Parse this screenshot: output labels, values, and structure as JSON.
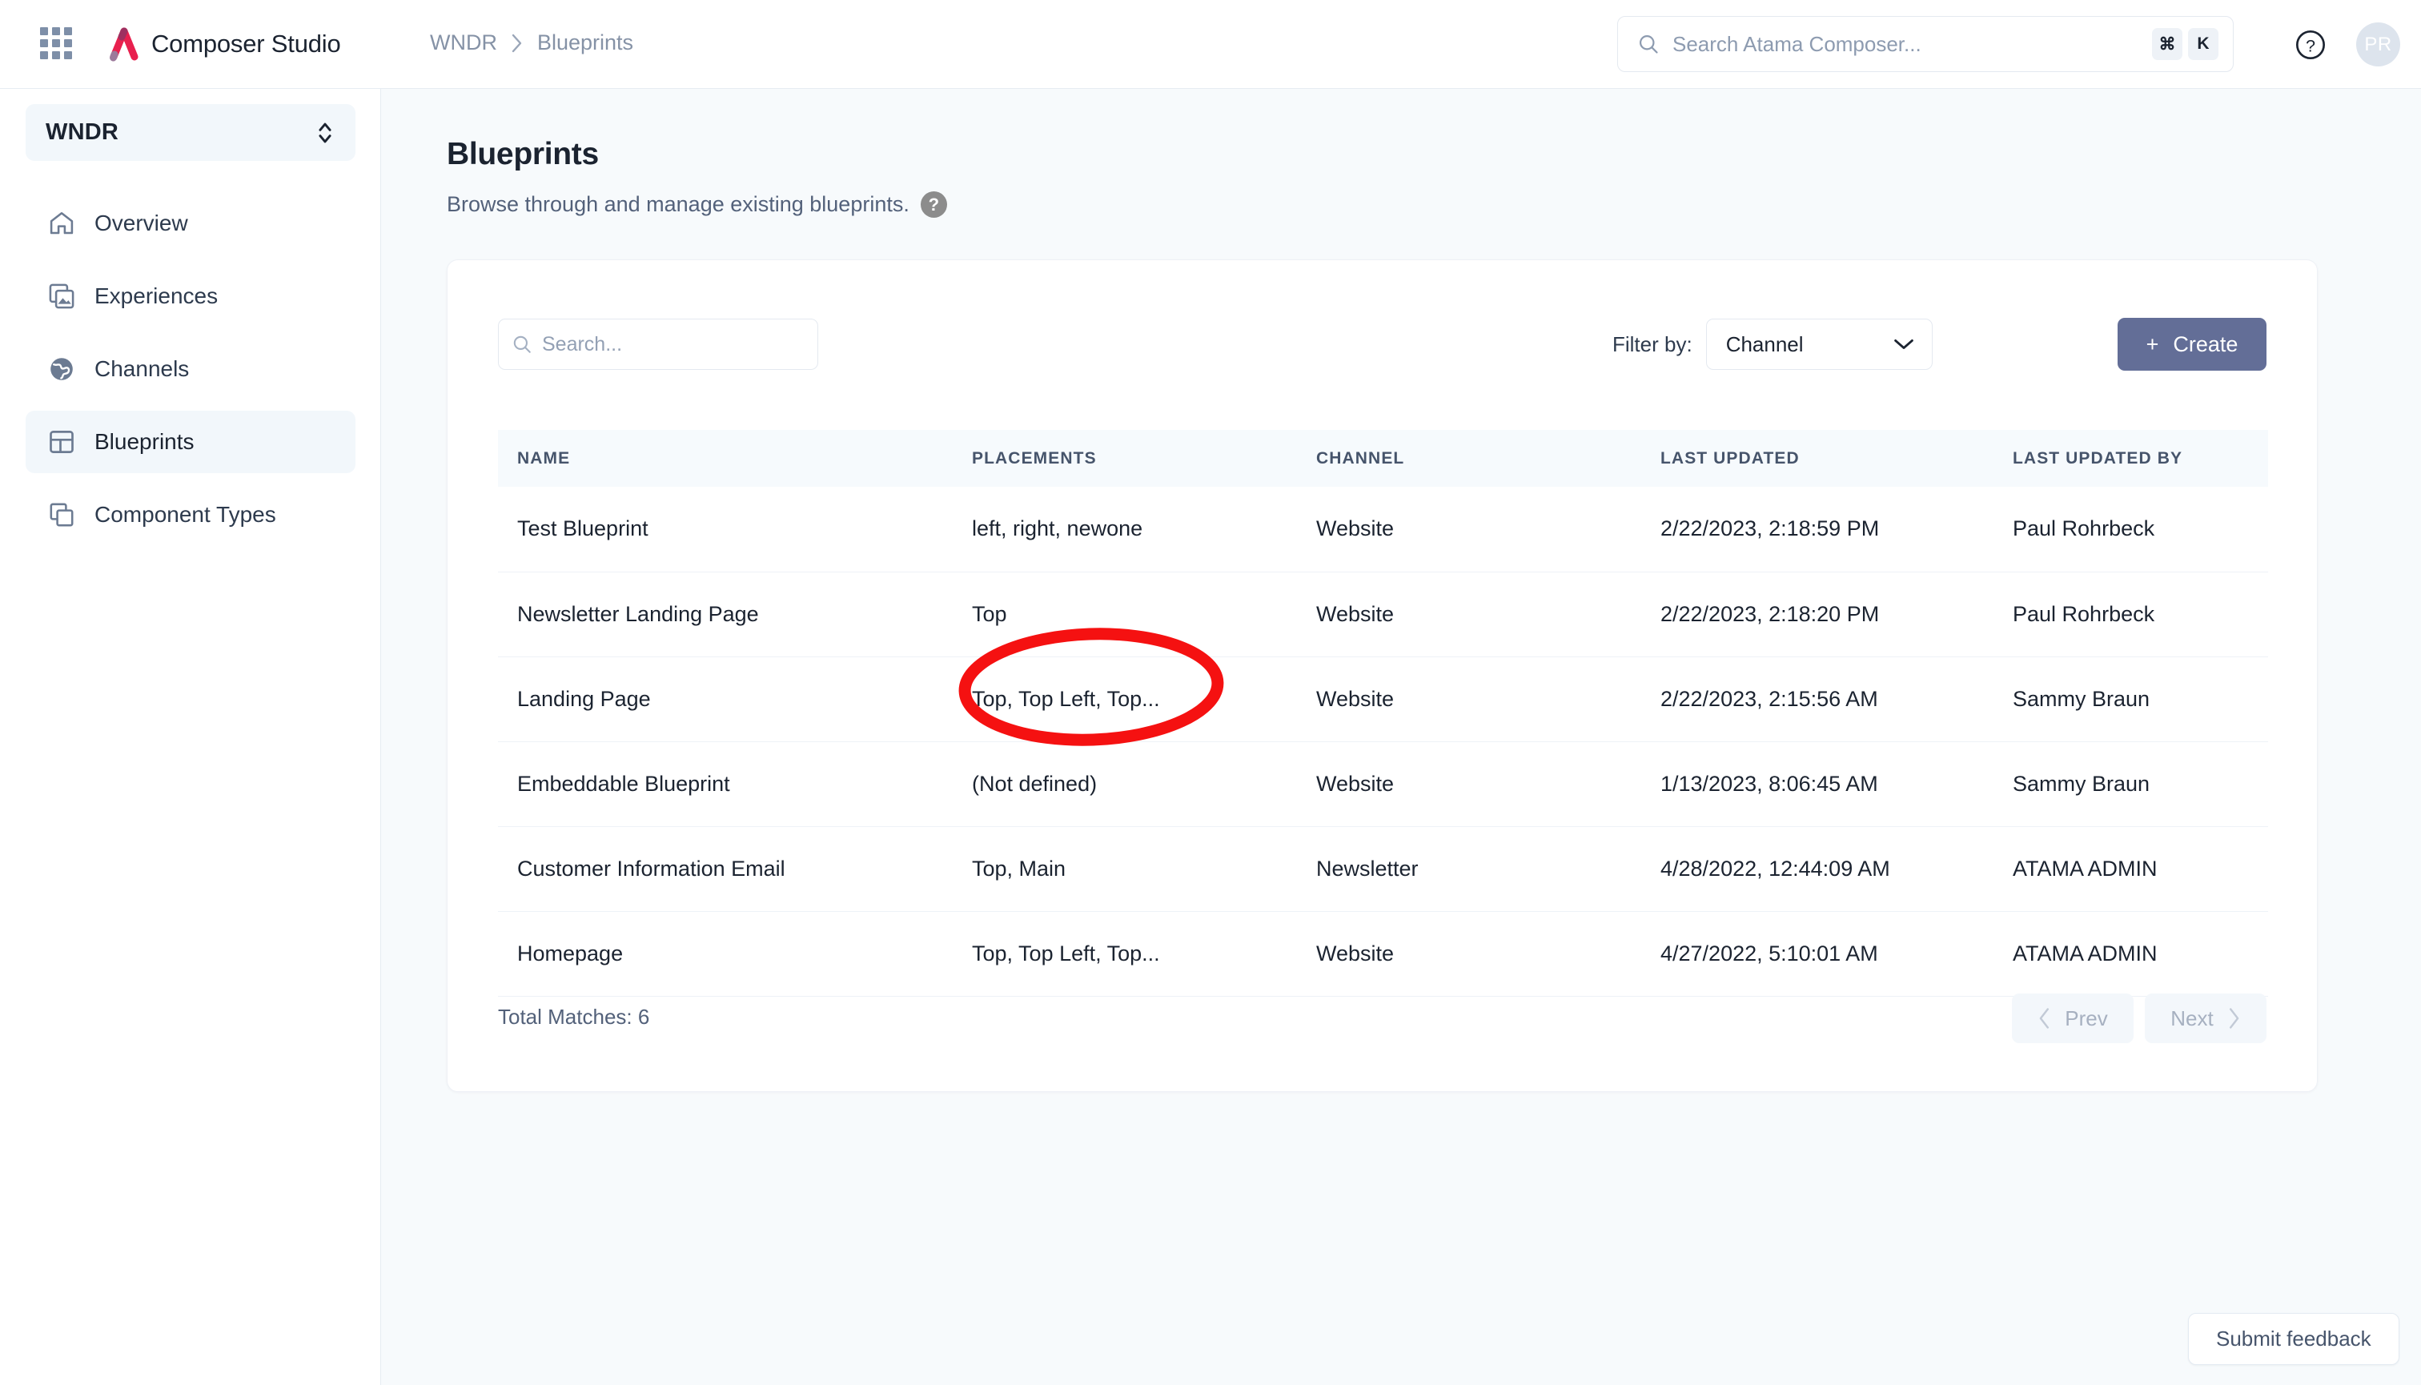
{
  "topbar": {
    "apps_icon": "apps-grid-icon",
    "brand_name": "Composer Studio",
    "breadcrumb": [
      "WNDR",
      "Blueprints"
    ],
    "search": {
      "placeholder": "Search Atama Composer...",
      "value": "",
      "shortcut_modifier": "⌘",
      "shortcut_key": "K"
    },
    "help_icon": "question-circle-icon",
    "avatar_initials": "PR"
  },
  "sidebar": {
    "org": "WNDR",
    "items": [
      {
        "label": "Overview",
        "icon": "home-icon",
        "active": false
      },
      {
        "label": "Experiences",
        "icon": "images-icon",
        "active": false
      },
      {
        "label": "Channels",
        "icon": "globe-icon",
        "active": false
      },
      {
        "label": "Blueprints",
        "icon": "layout-icon",
        "active": true
      },
      {
        "label": "Component Types",
        "icon": "copy-icon",
        "active": false
      }
    ]
  },
  "page": {
    "title": "Blueprints",
    "description": "Browse through and manage existing blueprints.",
    "help_glyph": "?"
  },
  "toolbar": {
    "search_placeholder": "Search...",
    "search_value": "",
    "filter_label": "Filter by:",
    "filter_value": "Channel",
    "create_label": "Create",
    "create_plus": "+",
    "create_color": "#636e97"
  },
  "table": {
    "columns": [
      "NAME",
      "PLACEMENTS",
      "CHANNEL",
      "LAST UPDATED",
      "LAST UPDATED BY"
    ],
    "rows": [
      {
        "name": "Test Blueprint",
        "placements": "left, right, newone",
        "channel": "Website",
        "last_updated": "2/22/2023, 2:18:59 PM",
        "last_updated_by": "Paul Rohrbeck"
      },
      {
        "name": "Newsletter Landing Page",
        "placements": "Top",
        "channel": "Website",
        "last_updated": "2/22/2023, 2:18:20 PM",
        "last_updated_by": "Paul Rohrbeck"
      },
      {
        "name": "Landing Page",
        "placements": "Top, Top Left, Top...",
        "channel": "Website",
        "last_updated": "2/22/2023, 2:15:56 AM",
        "last_updated_by": "Sammy Braun"
      },
      {
        "name": "Embeddable Blueprint",
        "placements": "(Not defined)",
        "channel": "Website",
        "last_updated": "1/13/2023, 8:06:45 AM",
        "last_updated_by": "Sammy Braun"
      },
      {
        "name": "Customer Information Email",
        "placements": "Top, Main",
        "channel": "Newsletter",
        "last_updated": "4/28/2022, 12:44:09 AM",
        "last_updated_by": "ATAMA ADMIN"
      },
      {
        "name": "Homepage",
        "placements": "Top, Top Left, Top...",
        "channel": "Website",
        "last_updated": "4/27/2022, 5:10:01 AM",
        "last_updated_by": "ATAMA ADMIN"
      }
    ]
  },
  "footer": {
    "total_matches": "Total Matches: 6",
    "prev_label": "Prev",
    "next_label": "Next"
  },
  "feedback": {
    "label": "Submit feedback"
  },
  "annotation": {
    "shape": "ellipse",
    "color": "#f51111",
    "targets": "Landing Page placements cell"
  }
}
